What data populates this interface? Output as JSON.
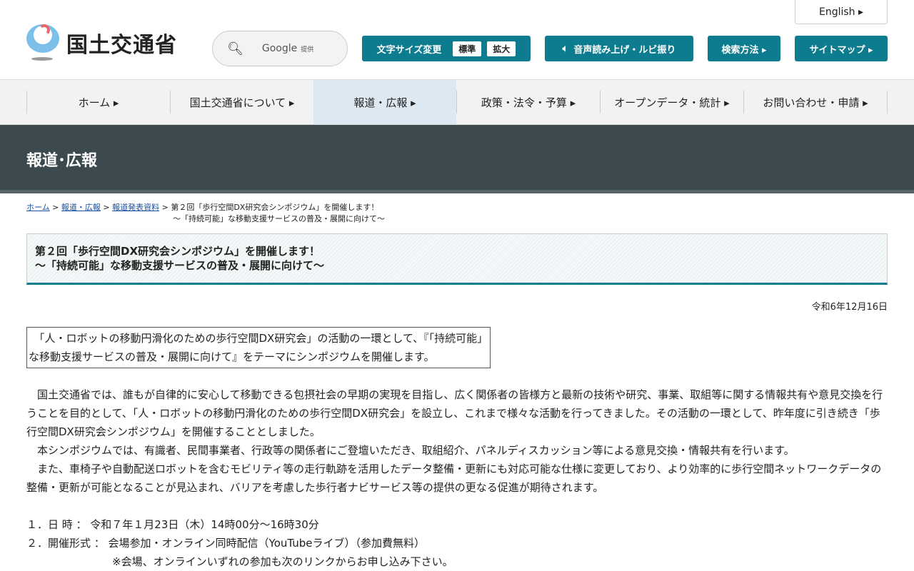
{
  "header": {
    "logo_text": "国土交通省",
    "search_provider": "Google",
    "search_provider_suffix": "提供",
    "english": "English ▸",
    "font_size_label": "文字サイズ変更",
    "font_standard": "標準",
    "font_large": "拡大",
    "audio": "音声読み上げ・ルビ振り",
    "search_method": "検索方法 ▸",
    "sitemap": "サイトマップ ▸"
  },
  "nav": [
    "ホーム ▸",
    "国土交通省について ▸",
    "報道・広報 ▸",
    "政策・法令・予算 ▸",
    "オープンデータ・統計 ▸",
    "お問い合わせ・申請 ▸"
  ],
  "banner": "報道･広報",
  "breadcrumb": {
    "home": "ホーム",
    "press": "報道・広報",
    "release": "報道発表資料",
    "current1": "第２回「歩行空間DX研究会シンポジウム」を開催します！",
    "current2": "～「持続可能」な移動支援サービスの普及・展開に向けて～"
  },
  "title": {
    "line1": "第２回「歩行空間DX研究会シンポジウム」を開催します！",
    "line2": "～「持続可能」な移動支援サービスの普及・展開に向けて～"
  },
  "date": "令和6年12月16日",
  "lead": "　「人・ロボットの移動円滑化のための歩行空間DX研究会」の活動の一環として、『「持続可能」な移動支援サービスの普及・展開に向けて』をテーマにシンポジウムを開催します。",
  "paragraphs": [
    "　国土交通省では、誰もが自律的に安心して移動できる包摂社会の早期の実現を目指し、広く関係者の皆様方と最新の技術や研究、事業、取組等に関する情報共有や意見交換を行うことを目的として、「人・ロボットの移動円滑化のための歩行空間DX研究会」を設立し、これまで様々な活動を行ってきました。その活動の一環として、昨年度に引き続き「歩行空間DX研究会シンポジウム」を開催することとしました。",
    "　本シンポジウムでは、有識者、民間事業者、行政等の関係者にご登壇いただき、取組紹介、パネルディスカッション等による意見交換・情報共有を行います。",
    "　また、車椅子や自動配送ロボットを含むモビリティ等の走行軌跡を活用したデータ整備・更新にも対応可能な仕様に変更しており、より効率的に歩行空間ネットワークデータの整備・更新が可能となることが見込まれ、バリアを考慮した歩行者ナビサービス等の提供の更なる促進が期待されます。"
  ],
  "items": [
    "１．日 時 ： 令和７年１月23日（木）14時00分～16時30分",
    "２．開催形式 ： 会場参加・オンライン同時配信（YouTubeライブ）（参加費無料）",
    "　　　　　　　　※会場、オンラインいずれの参加も次のリンクからお申し込み下さい。"
  ]
}
